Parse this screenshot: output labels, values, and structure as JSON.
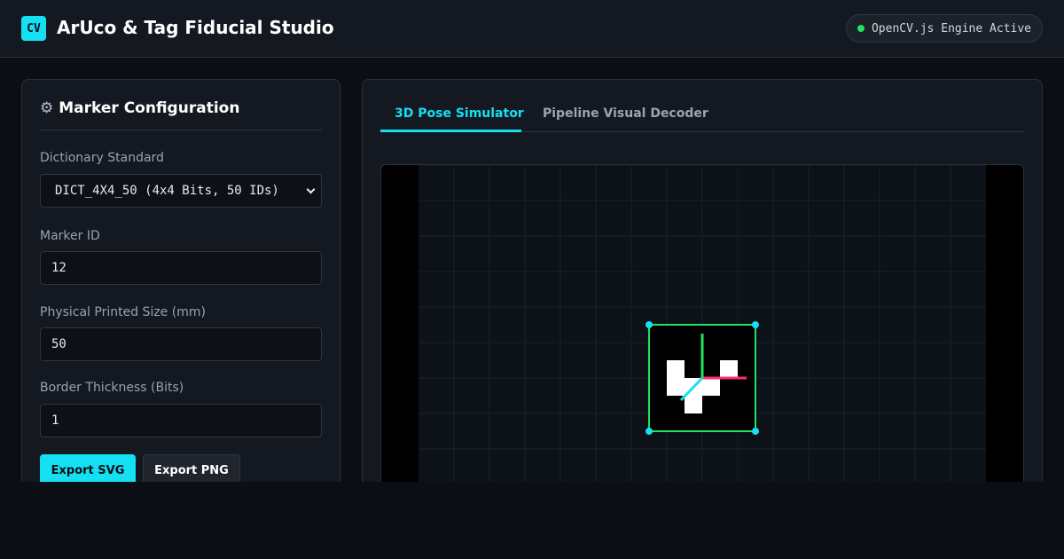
{
  "header": {
    "logo": "CV",
    "title": "ArUco & Tag Fiducial Studio",
    "status": "OpenCV.js Engine Active",
    "status_color": "#22e25c"
  },
  "config": {
    "title": "Marker Configuration",
    "title_icon": "gear-icon",
    "dictionary": {
      "label": "Dictionary Standard",
      "value": "DICT_4X4_50 (4x4 Bits, 50 IDs)"
    },
    "marker_id": {
      "label": "Marker ID",
      "value": "12"
    },
    "size": {
      "label": "Physical Printed Size (mm)",
      "value": "50"
    },
    "border": {
      "label": "Border Thickness (Bits)",
      "value": "1"
    },
    "buttons": {
      "export_svg": "Export SVG",
      "export_png": "Export PNG"
    }
  },
  "viewer": {
    "tabs": [
      {
        "label": "3D Pose Simulator",
        "active": true
      },
      {
        "label": "Pipeline Visual Decoder",
        "active": false
      }
    ]
  },
  "colors": {
    "accent": "#15e0f2",
    "detection_outline": "#22e25c",
    "axis_x": "#ff2d6f",
    "axis_y": "#22e25c",
    "axis_z": "#15e0f2"
  }
}
